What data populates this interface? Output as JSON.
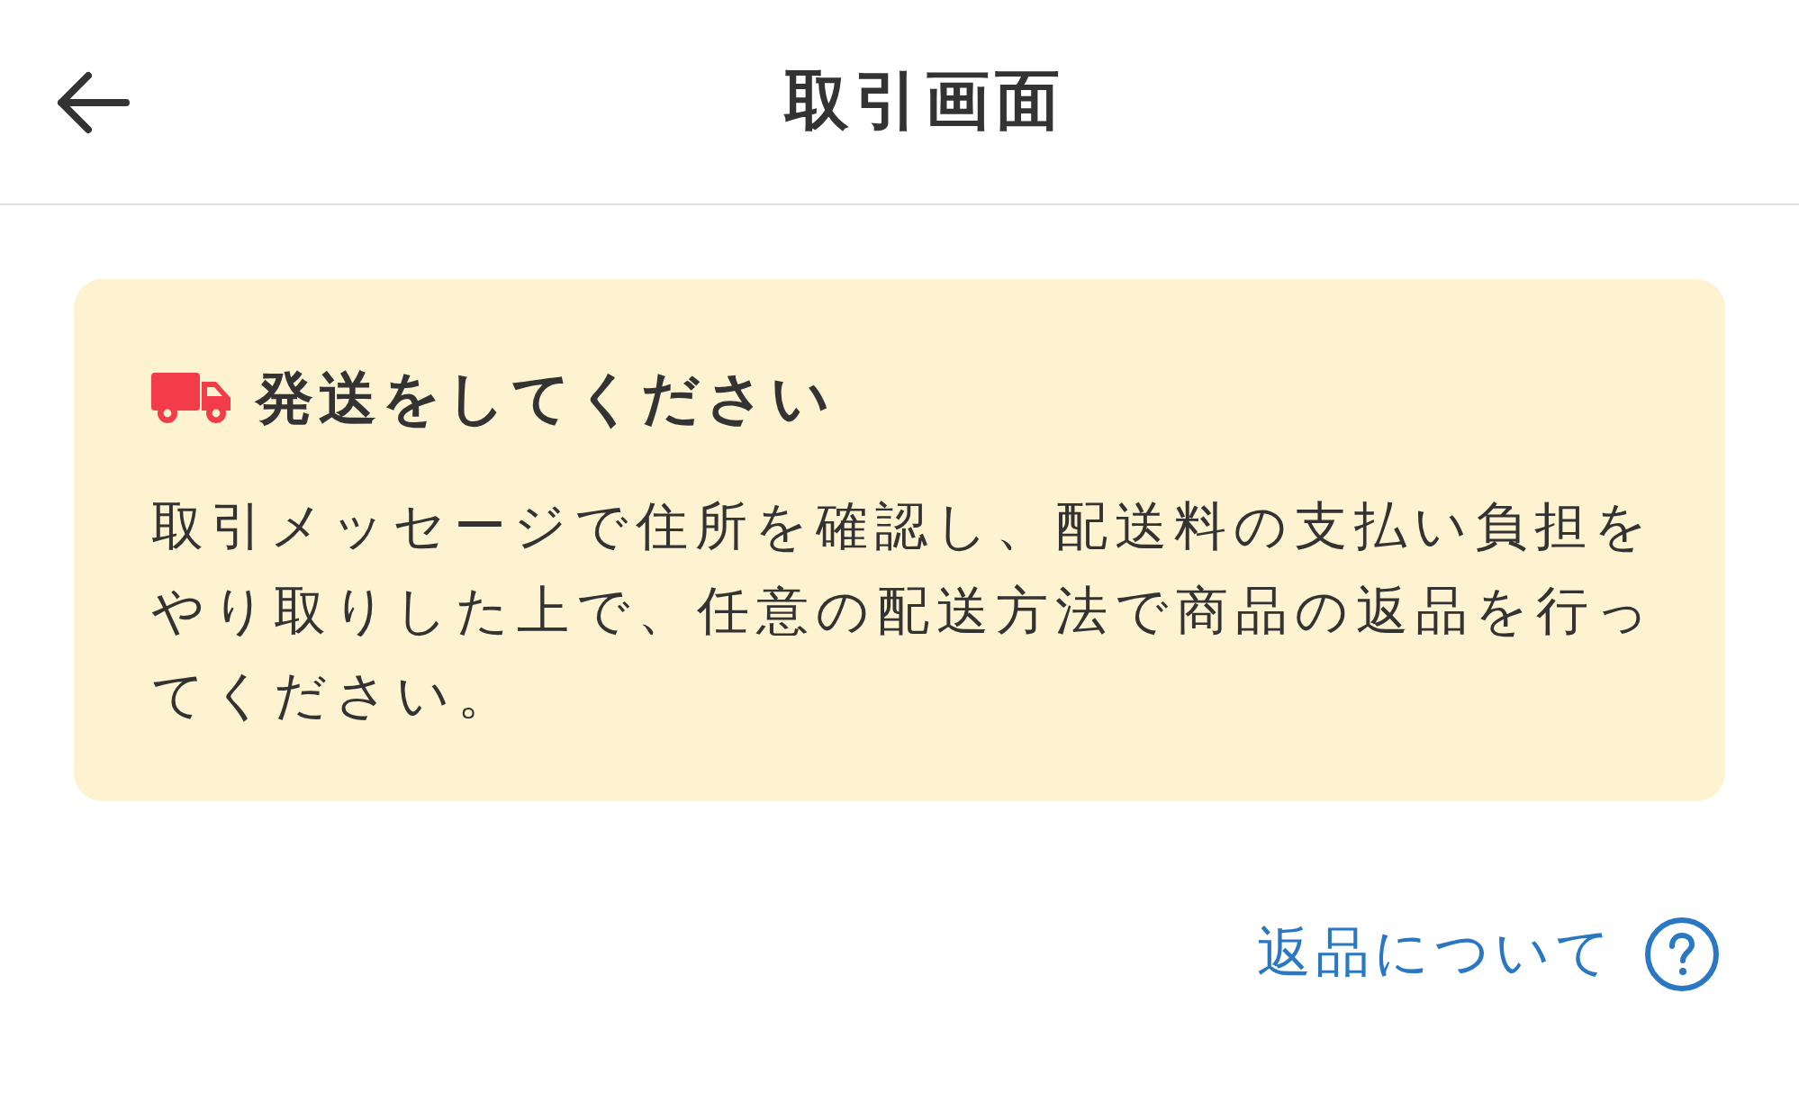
{
  "header": {
    "title": "取引画面"
  },
  "notice": {
    "title": "発送をしてください",
    "body": "取引メッセージで住所を確認し、配送料の支払い負担をやり取りした上で、任意の配送方法で商品の返品を行ってください。"
  },
  "help_link": {
    "label": "返品について"
  }
}
